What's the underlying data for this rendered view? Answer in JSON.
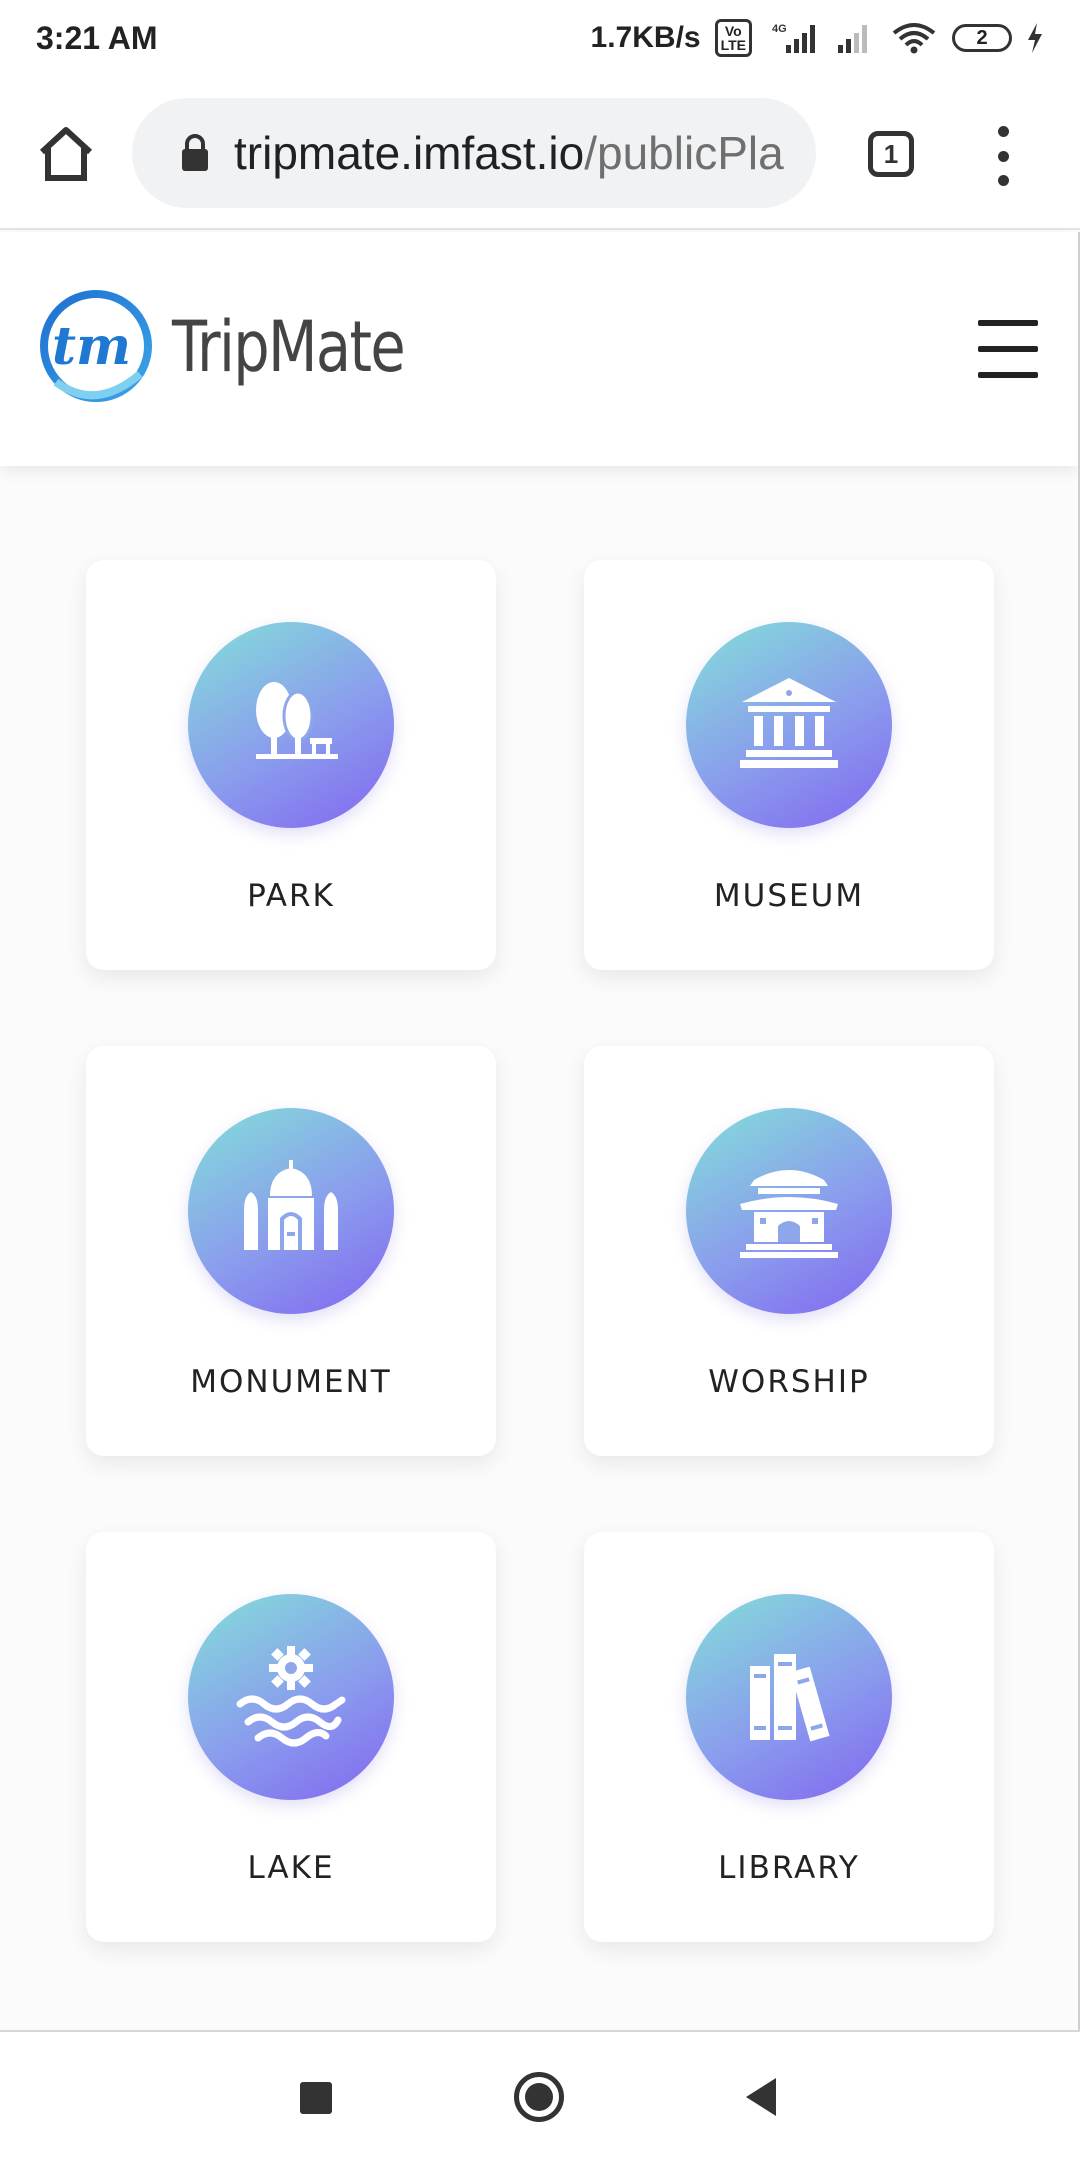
{
  "status_bar": {
    "time": "3:21 AM",
    "network_speed": "1.7KB/s",
    "volte_line1": "Vo",
    "volte_line2": "LTE",
    "network_type": "4G",
    "battery_level": "2"
  },
  "browser": {
    "url_host": "tripmate.imfast.io",
    "url_path": "/publicPla",
    "tab_count": "1"
  },
  "site": {
    "brand": "TripMate",
    "logo_text": "tm"
  },
  "categories": [
    {
      "label": "PARK",
      "icon": "park-icon"
    },
    {
      "label": "MUSEUM",
      "icon": "museum-icon"
    },
    {
      "label": "MONUMENT",
      "icon": "monument-icon"
    },
    {
      "label": "WORSHIP",
      "icon": "worship-icon"
    },
    {
      "label": "LAKE",
      "icon": "lake-icon"
    },
    {
      "label": "LIBRARY",
      "icon": "library-icon"
    }
  ],
  "colors": {
    "gradient_start": "#83dfd9",
    "gradient_end": "#8266f0"
  }
}
